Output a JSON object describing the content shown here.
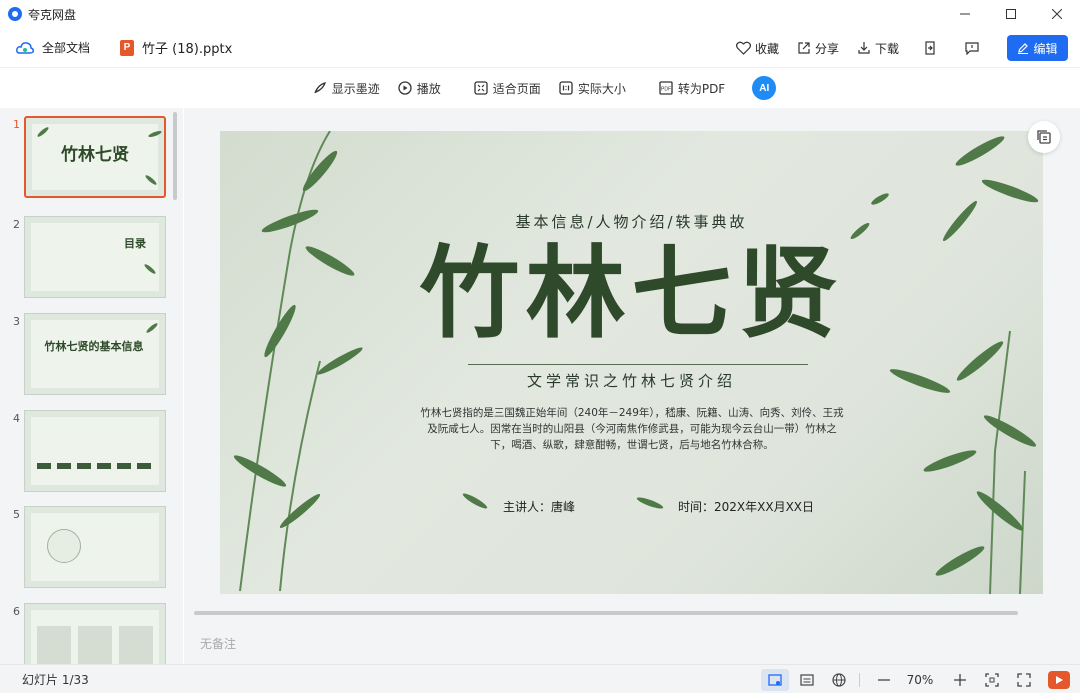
{
  "app": {
    "name": "夸克网盘"
  },
  "window": {
    "minimize": "—",
    "maximize": "☐",
    "close": "✕"
  },
  "header": {
    "all_docs": "全部文档",
    "file_badge": "P",
    "file_name": "竹子 (18).pptx",
    "actions": {
      "favorite": "收藏",
      "share": "分享",
      "download": "下载",
      "edit": "编辑"
    }
  },
  "toolbar": {
    "show_ink": "显示墨迹",
    "play": "播放",
    "fit_page": "适合页面",
    "actual_size": "实际大小",
    "to_pdf": "转为PDF",
    "ai_label": "AI"
  },
  "thumbnails": [
    {
      "num": "1",
      "title": "竹林七贤"
    },
    {
      "num": "2",
      "title": "目录"
    },
    {
      "num": "3",
      "title": "竹林七贤的基本信息"
    },
    {
      "num": "4",
      "title": ""
    },
    {
      "num": "5",
      "title": ""
    },
    {
      "num": "6",
      "title": ""
    }
  ],
  "slide": {
    "subtitle": "基本信息/人物介绍/轶事典故",
    "title": "竹林七贤",
    "subtitle2": "文学常识之竹林七贤介绍",
    "body": "竹林七贤指的是三国魏正始年间（240年－249年），嵇康、阮籍、山涛、向秀、刘伶、王戎及阮咸七人。因常在当时的山阳县（今河南焦作修武县，可能为现今云台山一带）竹林之下，喝酒、纵歌，肆意酣畅，世谓七贤，后与地名竹林合称。",
    "speaker": "主讲人：唐峰",
    "time": "时间：202X年XX月XX日"
  },
  "notes_placeholder": "无备注",
  "status": {
    "slide_count": "幻灯片 1/33",
    "zoom": "70%"
  },
  "colors": {
    "accent": "#1f6cf2",
    "ppt": "#e5582c",
    "slide_text": "#2f4a2a"
  }
}
